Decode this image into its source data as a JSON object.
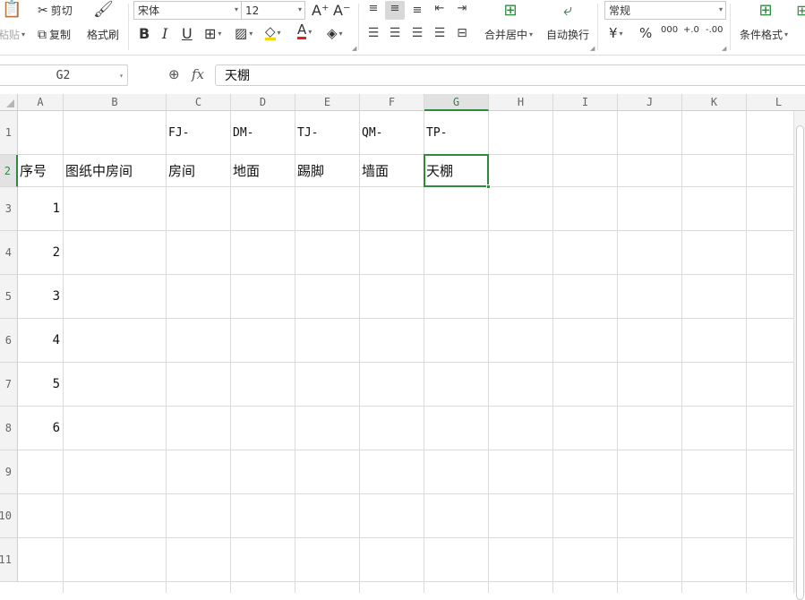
{
  "ribbon": {
    "paste_label": "粘贴",
    "cut_label": "剪切",
    "copy_label": "复制",
    "format_painter_label": "格式刷",
    "font_name": "宋体",
    "font_size": "12",
    "increase_font_glyph": "A⁺",
    "decrease_font_glyph": "A⁻",
    "bold": "B",
    "italic": "I",
    "underline": "U",
    "font_color_glyph": "A",
    "merge_center_label": "合并居中",
    "wrap_text_label": "自动换行",
    "number_format": "常规",
    "currency_glyph": "¥",
    "percent_glyph": "%",
    "thousands_glyph": "000",
    "inc_decimal_glyph": "+.0",
    "dec_decimal_glyph": "-.00",
    "conditional_format_label": "条件格式"
  },
  "formula_bar": {
    "name_box": "G2",
    "fx_label": "fx",
    "formula": "天棚"
  },
  "grid": {
    "columns": [
      "A",
      "B",
      "C",
      "D",
      "E",
      "F",
      "G",
      "H",
      "I",
      "J",
      "K",
      "L"
    ],
    "rows": [
      "1",
      "2",
      "3",
      "4",
      "5",
      "6",
      "7",
      "8",
      "9",
      "10",
      "11"
    ],
    "active_column": "G",
    "active_row": "2",
    "cells": {
      "C1": "FJ-",
      "D1": "DM-",
      "E1": "TJ-",
      "F1": "QM-",
      "G1": "TP-",
      "A2": "序号",
      "B2": "图纸中房间",
      "C2": "房间",
      "D2": "地面",
      "E2": "踢脚",
      "F2": "墙面",
      "G2": "天棚",
      "A3": "1",
      "A4": "2",
      "A5": "3",
      "A6": "4",
      "A7": "5",
      "A8": "6"
    }
  },
  "colors": {
    "accent": "#2e8b3e",
    "header_bg": "#f3f3f3",
    "gridline": "#dadada"
  }
}
